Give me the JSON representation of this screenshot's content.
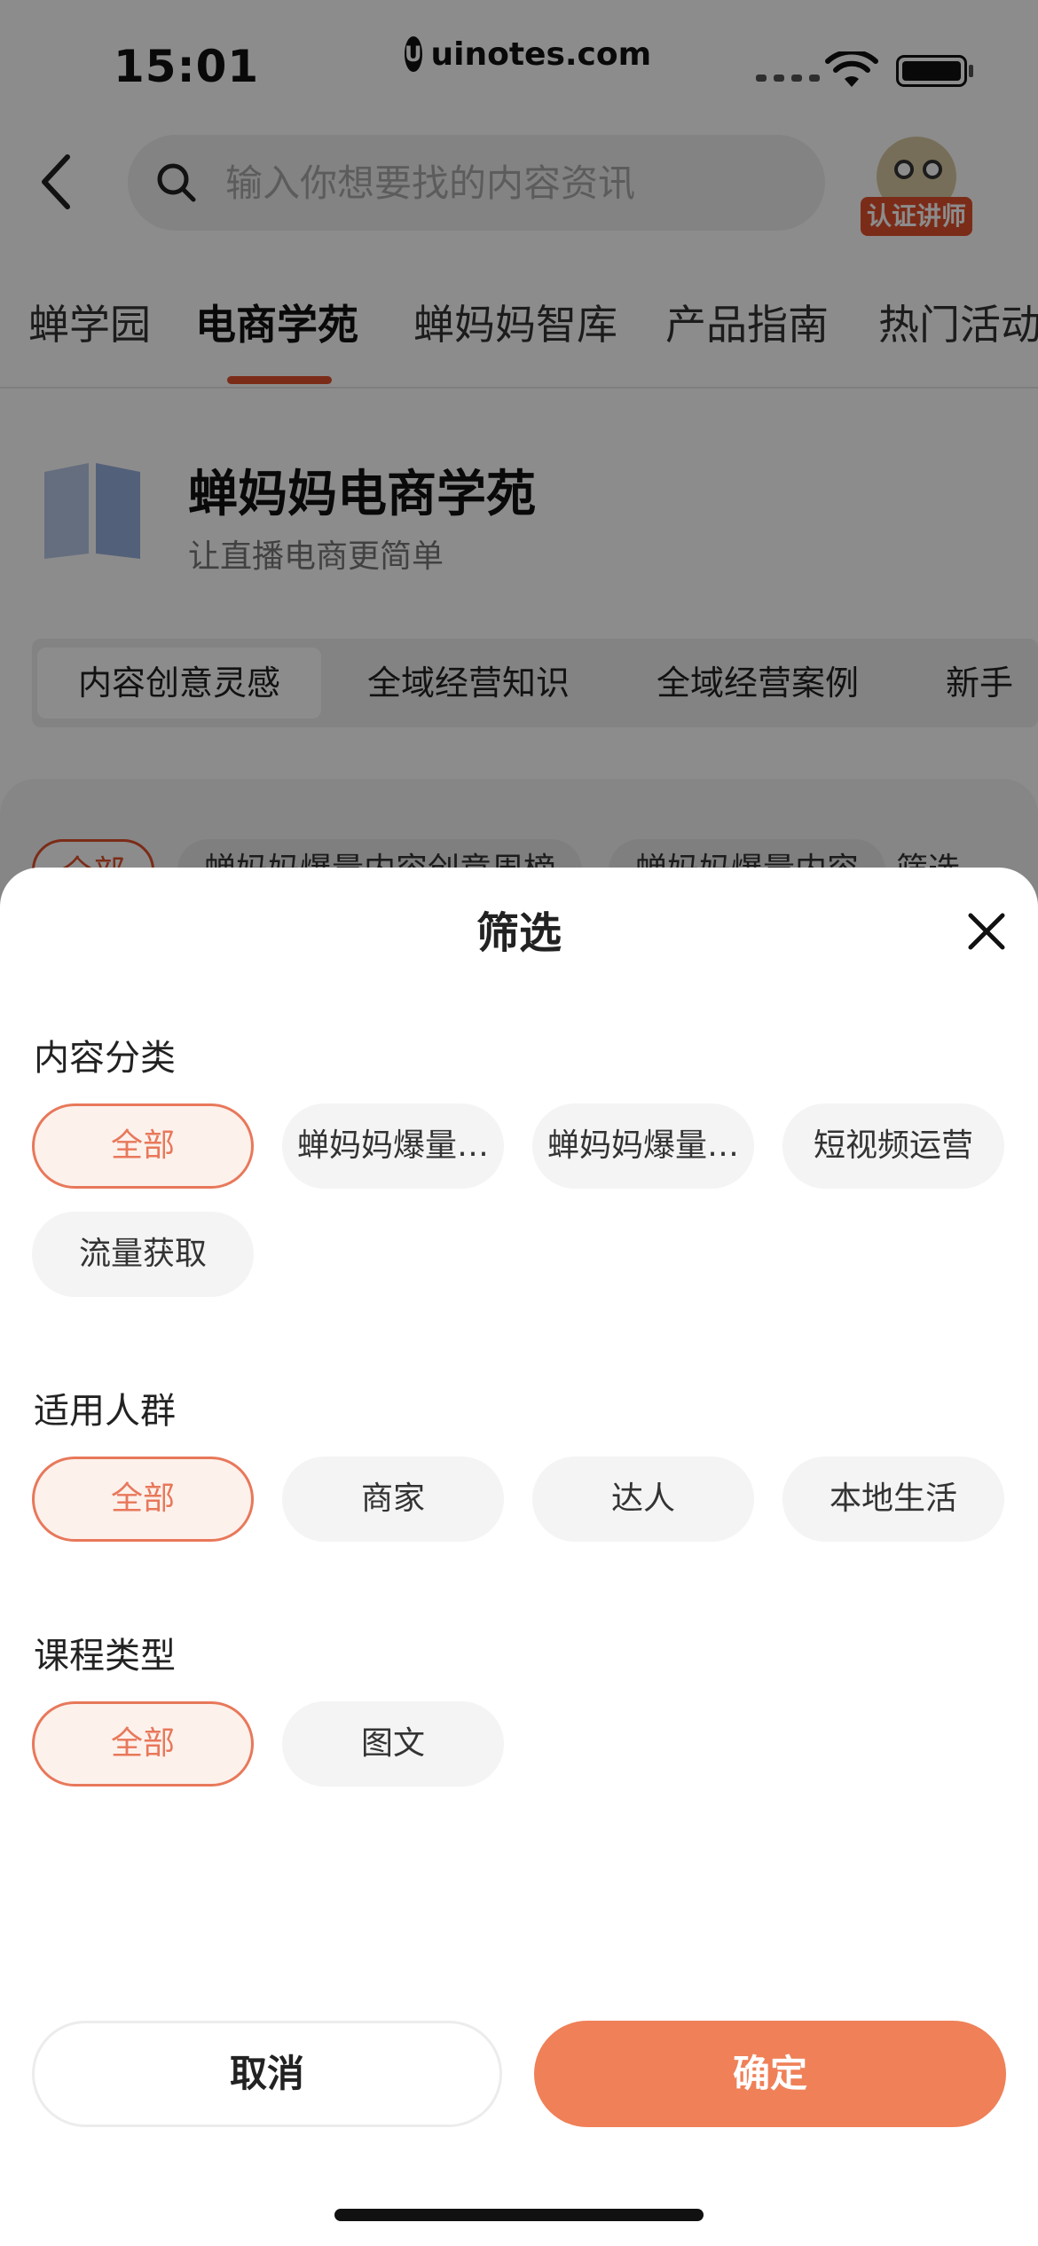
{
  "status_bar": {
    "time": "15:01",
    "watermark": "uinotes.com",
    "watermark_logo": "U"
  },
  "header": {
    "search_placeholder": "输入你想要找的内容资讯",
    "avatar_badge": "认证讲师"
  },
  "top_tabs": [
    {
      "label": "蝉学园"
    },
    {
      "label": "电商学苑",
      "active": true
    },
    {
      "label": "蝉妈妈智库"
    },
    {
      "label": "产品指南"
    },
    {
      "label": "热门活动"
    }
  ],
  "academy": {
    "title": "蝉妈妈电商学苑",
    "subtitle": "让直播电商更简单"
  },
  "category_tabs": [
    {
      "label": "内容创意灵感",
      "active": true
    },
    {
      "label": "全域经营知识"
    },
    {
      "label": "全域经营案例"
    },
    {
      "label": "新手"
    }
  ],
  "list_chips_behind": [
    {
      "label": "全部",
      "active": true
    },
    {
      "label": "蝉妈妈爆量内容创意周榜"
    },
    {
      "label": "蝉妈妈爆量内容"
    },
    {
      "label": "筛选"
    }
  ],
  "sheet": {
    "title": "筛选",
    "sections": [
      {
        "label": "内容分类",
        "options": [
          "全部",
          "蝉妈妈爆量…",
          "蝉妈妈爆量…",
          "短视频运营",
          "流量获取"
        ]
      },
      {
        "label": "适用人群",
        "options": [
          "全部",
          "商家",
          "达人",
          "本地生活"
        ]
      },
      {
        "label": "课程类型",
        "options": [
          "全部",
          "图文"
        ]
      }
    ],
    "cancel_label": "取消",
    "confirm_label": "确定"
  },
  "colors": {
    "accent": "#e8785a",
    "confirm": "#ef8058",
    "tab_indicator": "#e0512c"
  }
}
